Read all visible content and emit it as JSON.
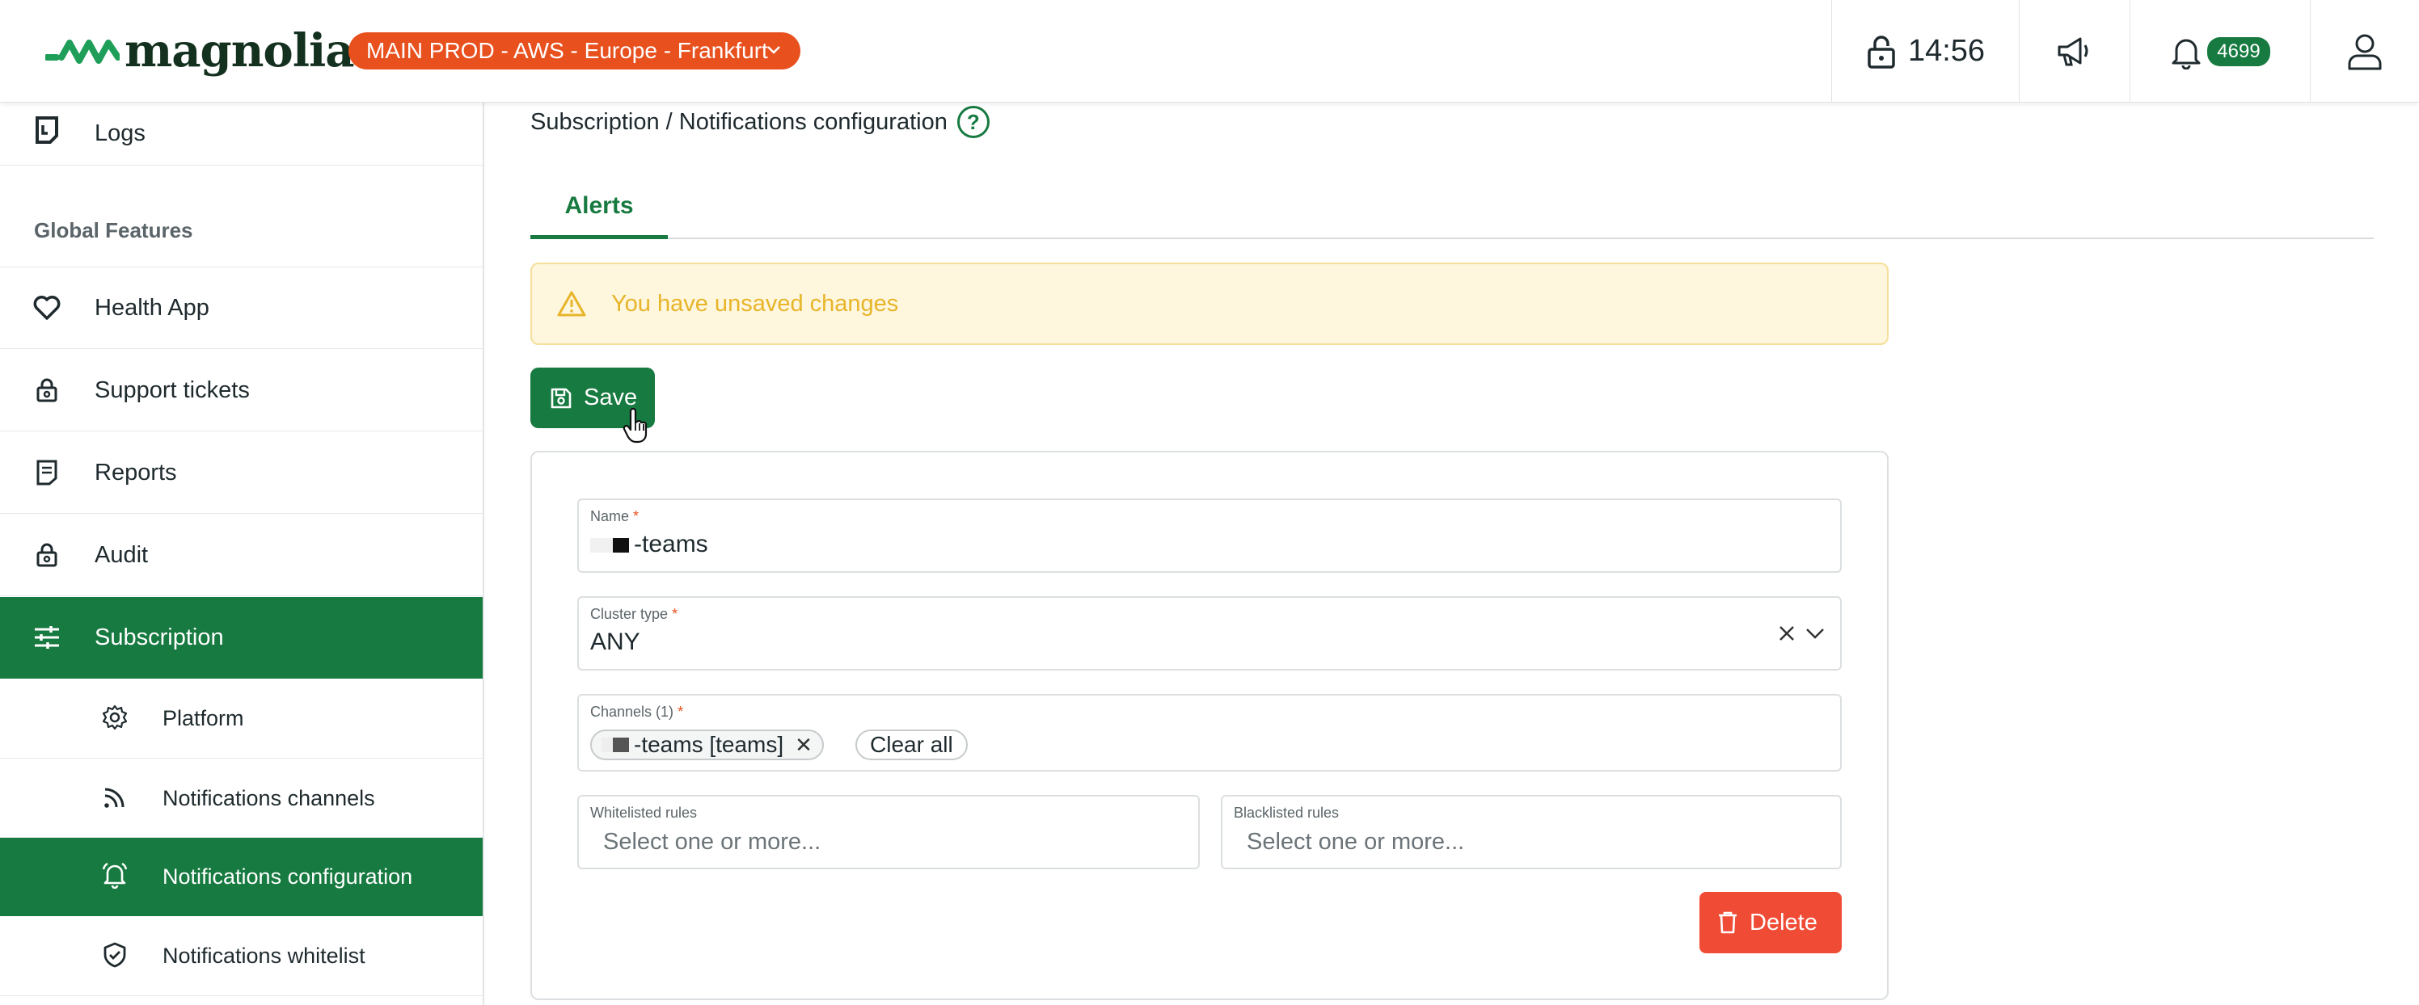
{
  "header": {
    "brand": "magnolia",
    "environment": "MAIN PROD - AWS - Europe - Frankfurt",
    "clock": "14:56",
    "notification_count": "4699"
  },
  "sidebar": {
    "items": [
      {
        "label": "Logs"
      },
      {
        "label": "Health App"
      },
      {
        "label": "Support tickets"
      },
      {
        "label": "Reports"
      },
      {
        "label": "Audit"
      },
      {
        "label": "Subscription"
      },
      {
        "label": "Platform"
      },
      {
        "label": "Notifications channels"
      },
      {
        "label": "Notifications configuration"
      },
      {
        "label": "Notifications whitelist"
      }
    ],
    "section_global": "Global Features"
  },
  "main": {
    "breadcrumb": "Subscription / Notifications configuration",
    "help": "?",
    "tab_alerts": "Alerts",
    "warning": "You have unsaved changes",
    "save_label": "Save",
    "form": {
      "name_label": "Name",
      "name_value": "-teams",
      "cluster_label": "Cluster type",
      "cluster_value": "ANY",
      "channels_label": "Channels (1)",
      "channel_chip": "-teams [teams]",
      "clear_all": "Clear all",
      "whitelist_label": "Whitelisted rules",
      "whitelist_placeholder": "Select one or more...",
      "blacklist_label": "Blacklisted rules",
      "blacklist_placeholder": "Select one or more...",
      "required_mark": "*",
      "delete_label": "Delete"
    }
  },
  "colors": {
    "brand_green": "#177a40",
    "env_orange": "#e8501e",
    "delete_red": "#f04b35",
    "warning_text": "#e8b52a",
    "warning_bg": "#fef6dd"
  }
}
